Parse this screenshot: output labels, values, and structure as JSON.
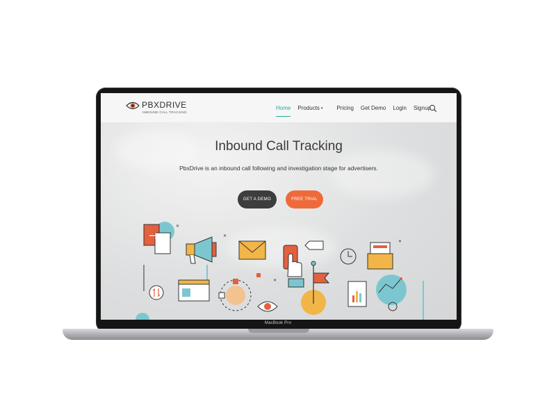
{
  "brand": {
    "name": "PBXDRIVE",
    "tagline": "INBOUND CALL TRACKING"
  },
  "nav": {
    "items": [
      {
        "label": "Home",
        "active": true
      },
      {
        "label": "Products",
        "has_caret": true
      },
      {
        "label": "Pricing"
      },
      {
        "label": "Get Demo"
      },
      {
        "label": "Login"
      },
      {
        "label": "Signup"
      }
    ],
    "search_icon": "search-icon"
  },
  "hero": {
    "title": "Inbound Call Tracking",
    "subtitle": "PbxDrive is an inbound call following and investigation stage for advertisers.",
    "primary_button": "GET A DEMO",
    "secondary_button": "FREE TRIAL"
  },
  "device": {
    "label": "MacBook Pro"
  },
  "colors": {
    "accent_teal": "#2aa79a",
    "accent_orange": "#ef6a3b",
    "dark_button": "#3d3d3d",
    "illustration_blue": "#7cc7cf",
    "illustration_yellow": "#f2b548",
    "illustration_red": "#e4603f"
  }
}
